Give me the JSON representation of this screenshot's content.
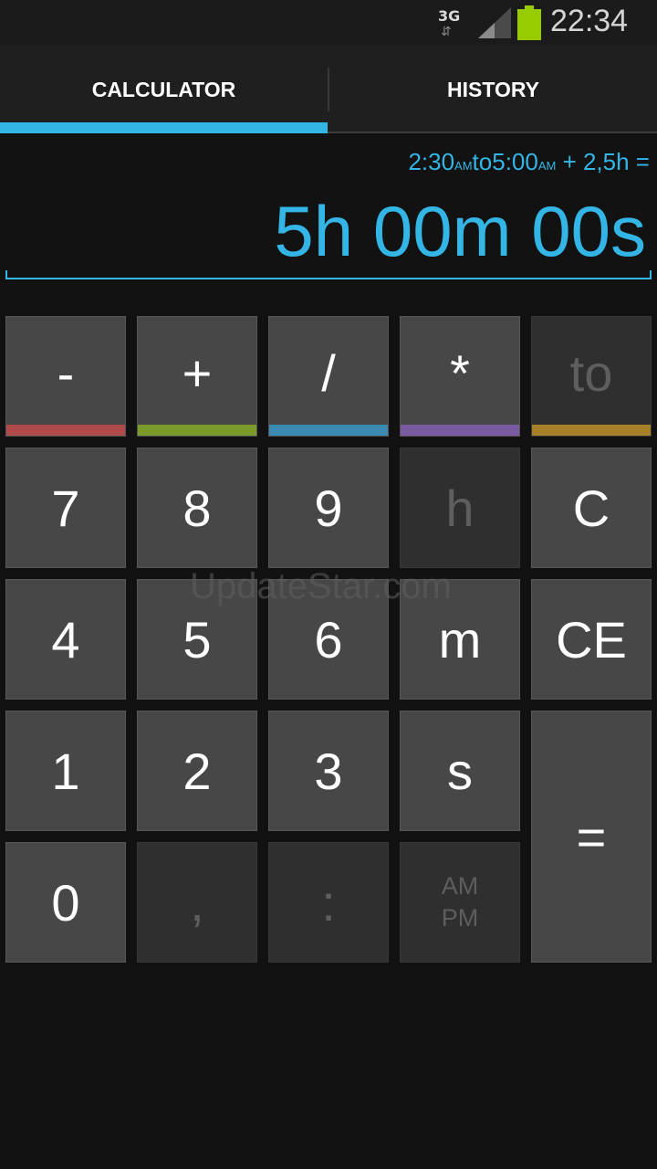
{
  "status_bar": {
    "network": "3G",
    "network_activity": "⇵",
    "signal_icon": "signal-icon",
    "battery_icon": "battery-icon",
    "battery_color": "#99cc00",
    "time": "22:34"
  },
  "tabs": {
    "calculator": "CALCULATOR",
    "history": "HISTORY",
    "active": "calculator",
    "accent_color": "#33b5e5"
  },
  "display": {
    "expr_t1": "2:30",
    "expr_ampm1": "AM",
    "expr_to": "to",
    "expr_t2": "5:00",
    "expr_ampm2": "AM",
    "expr_rest": " + 2,5h =",
    "result": "5h 00m 00s"
  },
  "keys": {
    "minus": "-",
    "plus": "+",
    "divide": "/",
    "multiply": "*",
    "to": "to",
    "seven": "7",
    "eight": "8",
    "nine": "9",
    "h": "h",
    "clear": "C",
    "four": "4",
    "five": "5",
    "six": "6",
    "m": "m",
    "clear_entry": "CE",
    "one": "1",
    "two": "2",
    "three": "3",
    "s": "s",
    "equals": "=",
    "zero": "0",
    "comma": ",",
    "colon": ":",
    "ampm": "AM\nPM"
  },
  "stripe_colors": {
    "minus": "#b04a4a",
    "plus": "#7a9a2a",
    "divide": "#3b8ab0",
    "multiply": "#7a5aa0",
    "to": "#a8802a"
  },
  "watermark": "UpdateStar.com"
}
